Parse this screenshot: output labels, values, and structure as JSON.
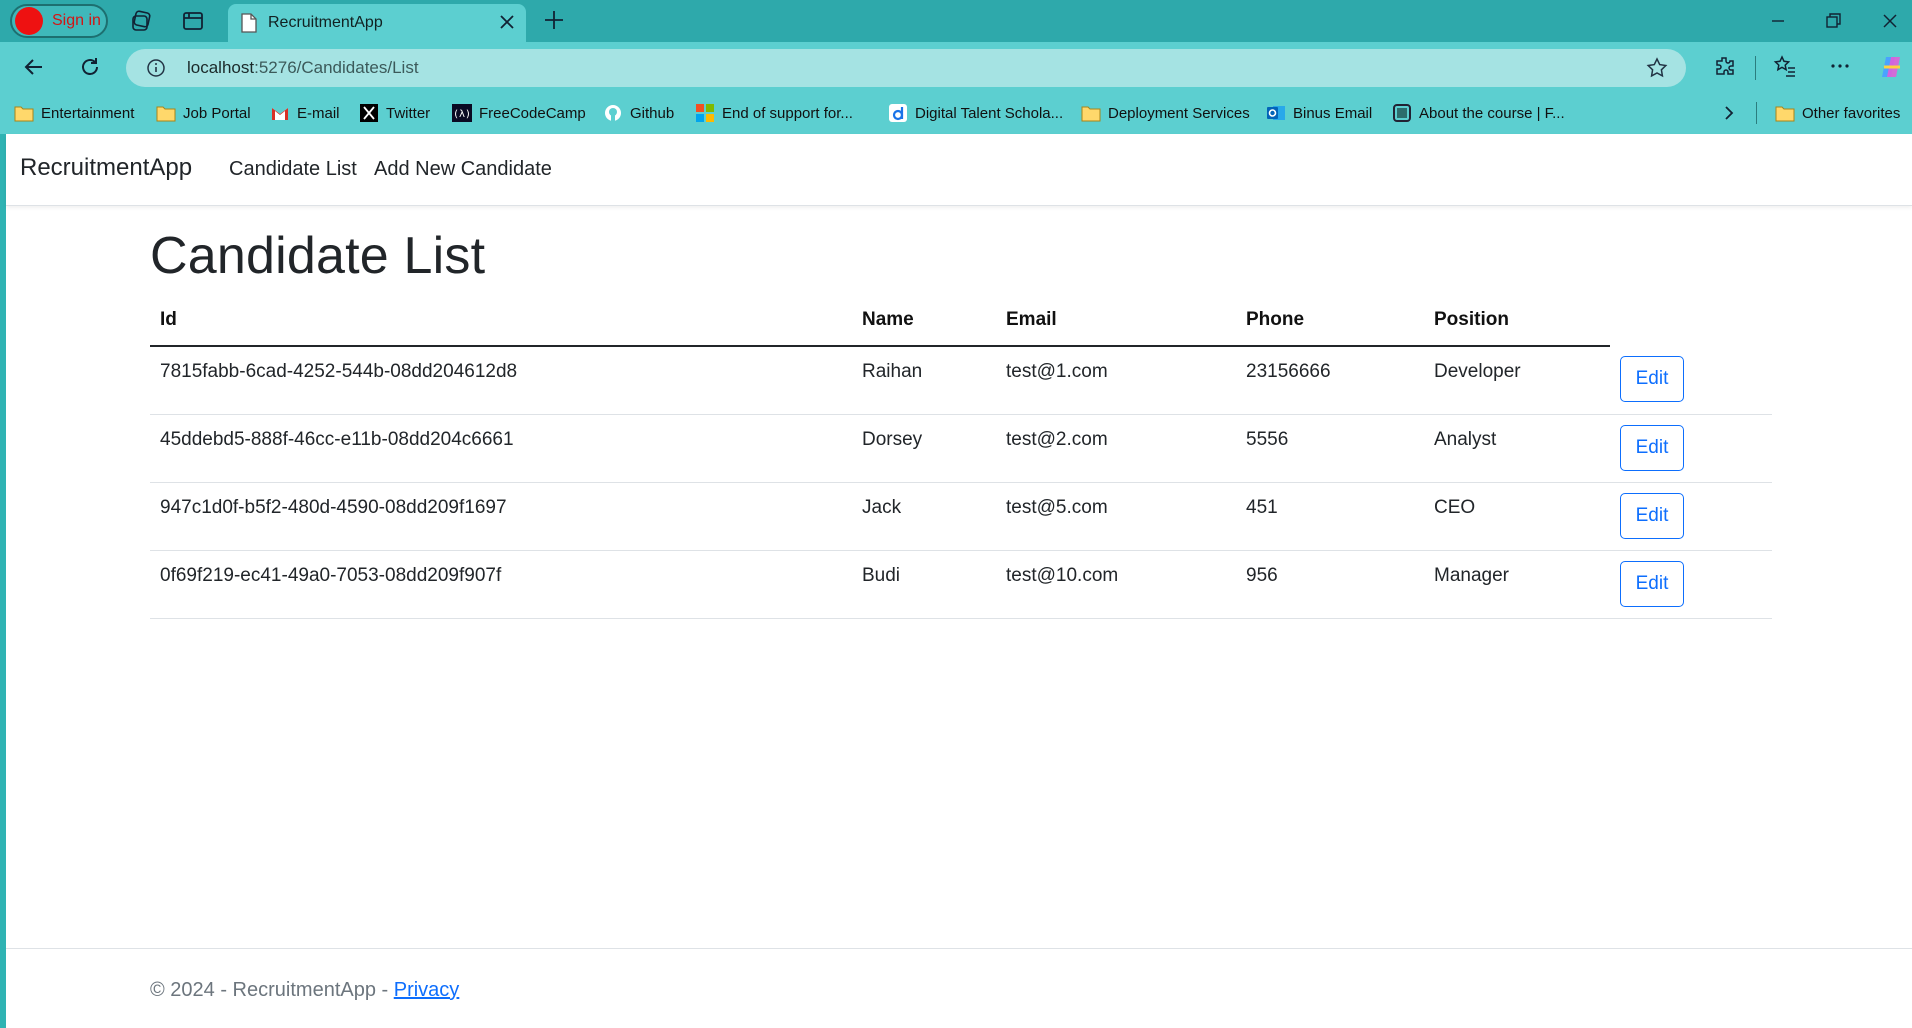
{
  "browser": {
    "signin_label": "Sign in",
    "tab_title": "RecruitmentApp",
    "url_host": "localhost",
    "url_path": ":5276/Candidates/List",
    "bookmarks": [
      {
        "label": "Entertainment",
        "icon": "folder-icon"
      },
      {
        "label": "Job Portal",
        "icon": "folder-icon"
      },
      {
        "label": "E-mail",
        "icon": "gmail-icon"
      },
      {
        "label": "Twitter",
        "icon": "x-icon"
      },
      {
        "label": "FreeCodeCamp",
        "icon": "freecodecamp-icon"
      },
      {
        "label": "Github",
        "icon": "github-icon"
      },
      {
        "label": "End of support for...",
        "icon": "microsoft-icon"
      },
      {
        "label": "Digital Talent Schola...",
        "icon": "dts-icon"
      },
      {
        "label": "Deployment Services",
        "icon": "folder-icon"
      },
      {
        "label": "Binus Email",
        "icon": "outlook-icon"
      },
      {
        "label": "About the course | F...",
        "icon": "course-icon"
      }
    ],
    "other_favorites": "Other favorites"
  },
  "nav": {
    "brand": "RecruitmentApp",
    "links": [
      "Candidate List",
      "Add New Candidate"
    ]
  },
  "main": {
    "title": "Candidate List",
    "columns": [
      "Id",
      "Name",
      "Email",
      "Phone",
      "Position"
    ],
    "edit_label": "Edit",
    "rows": [
      {
        "id": "7815fabb-6cad-4252-544b-08dd204612d8",
        "name": "Raihan",
        "email": "test@1.com",
        "phone": "23156666",
        "position": "Developer"
      },
      {
        "id": "45ddebd5-888f-46cc-e11b-08dd204c6661",
        "name": "Dorsey",
        "email": "test@2.com",
        "phone": "5556",
        "position": "Analyst"
      },
      {
        "id": "947c1d0f-b5f2-480d-4590-08dd209f1697",
        "name": "Jack",
        "email": "test@5.com",
        "phone": "451",
        "position": "CEO"
      },
      {
        "id": "0f69f219-ec41-49a0-7053-08dd209f907f",
        "name": "Budi",
        "email": "test@10.com",
        "phone": "956",
        "position": "Manager"
      }
    ]
  },
  "footer": {
    "text": "© 2024 - RecruitmentApp - ",
    "privacy": "Privacy"
  }
}
